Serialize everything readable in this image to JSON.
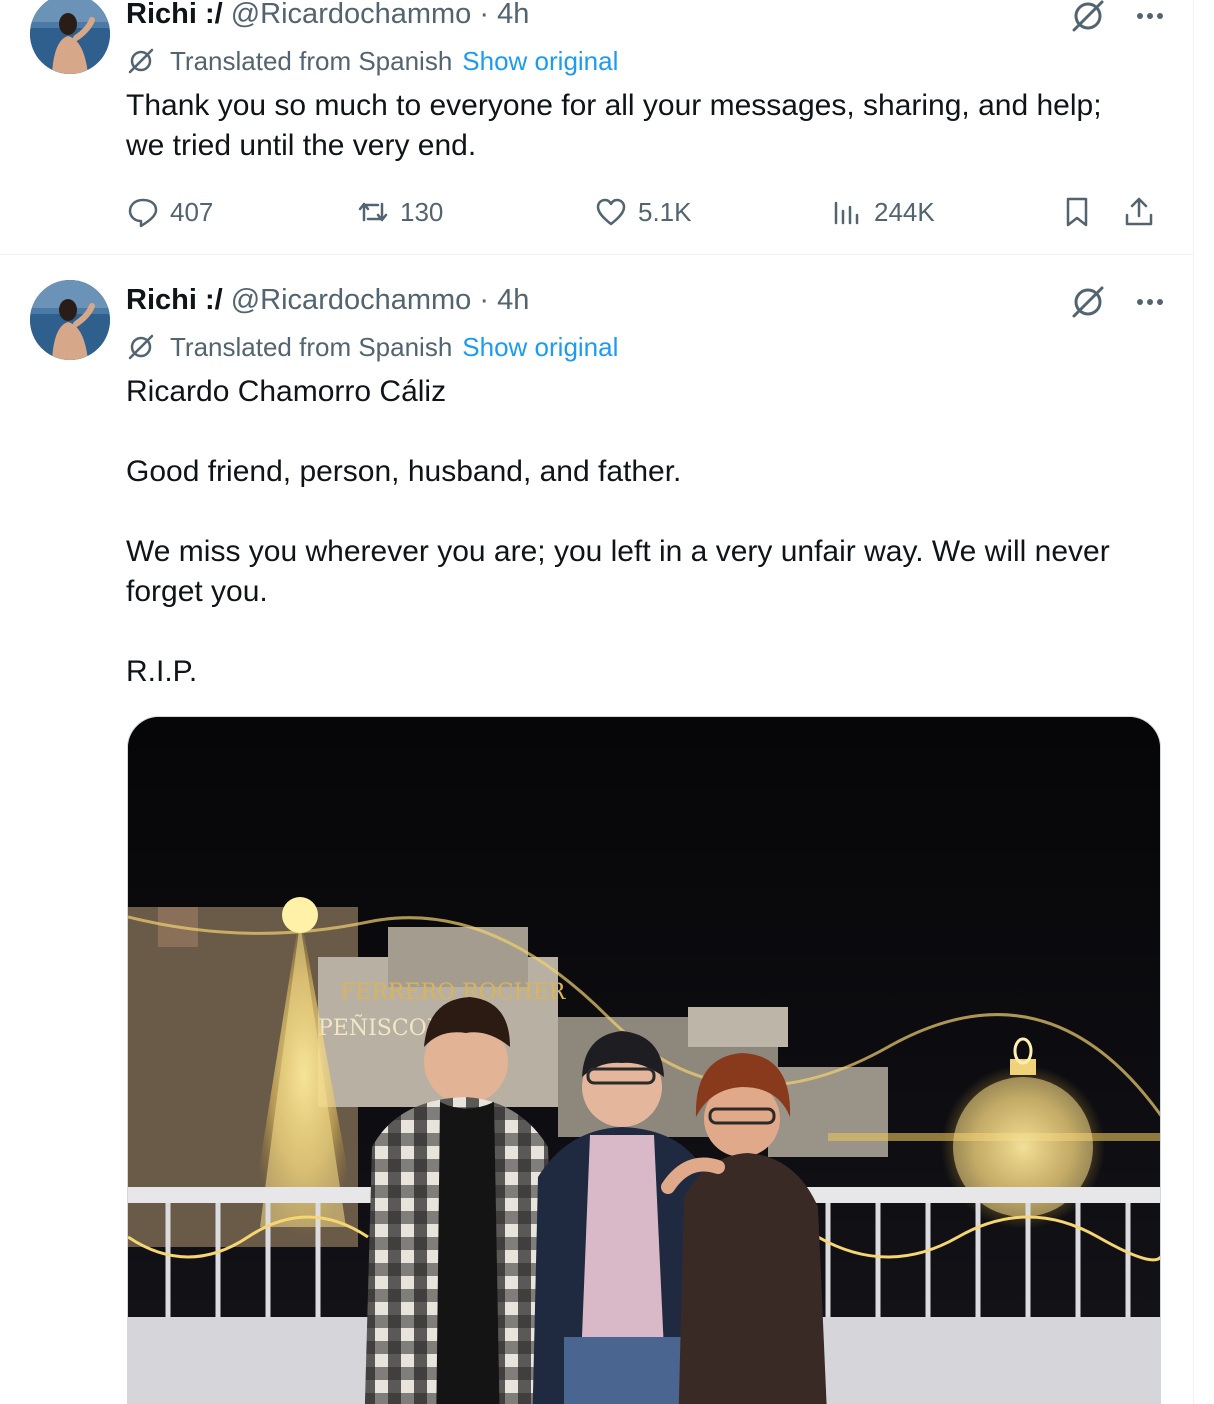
{
  "tweets": [
    {
      "display_name": "Richi :/",
      "handle": "@Ricardochammo",
      "separator": "·",
      "time": "4h",
      "translated_label": "Translated from Spanish",
      "show_original": "Show original",
      "body": [
        "Thank you so much to everyone for all your messages, sharing, and help;",
        "we tried until the very end."
      ],
      "stats": {
        "replies": "407",
        "reposts": "130",
        "likes": "5.1K",
        "views": "244K"
      }
    },
    {
      "display_name": "Richi :/",
      "handle": "@Ricardochammo",
      "separator": "·",
      "time": "4h",
      "translated_label": "Translated from Spanish",
      "show_original": "Show original",
      "body": [
        "Ricardo Chamorro Cáliz",
        "",
        "Good friend, person, husband, and father.",
        "",
        "We miss you wherever you are; you left in a very unfair way. We will never",
        "forget you.",
        "",
        "R.I.P."
      ],
      "image": {
        "alt": "Three people posing on a balcony at night in front of Christmas light decorations",
        "sign_text_1": "FERRERO ROCHER",
        "sign_text_2": "PEÑISCOLA"
      }
    }
  ],
  "icons": {
    "grok": "grok-icon",
    "more": "more-icon",
    "translate": "translate-icon",
    "reply": "reply-icon",
    "repost": "repost-icon",
    "like": "like-icon",
    "views": "views-icon",
    "bookmark": "bookmark-icon",
    "share": "share-icon"
  },
  "colors": {
    "text_primary": "#0f1419",
    "text_secondary": "#536471",
    "link": "#1d9bf0",
    "divider": "#eff3f4"
  }
}
